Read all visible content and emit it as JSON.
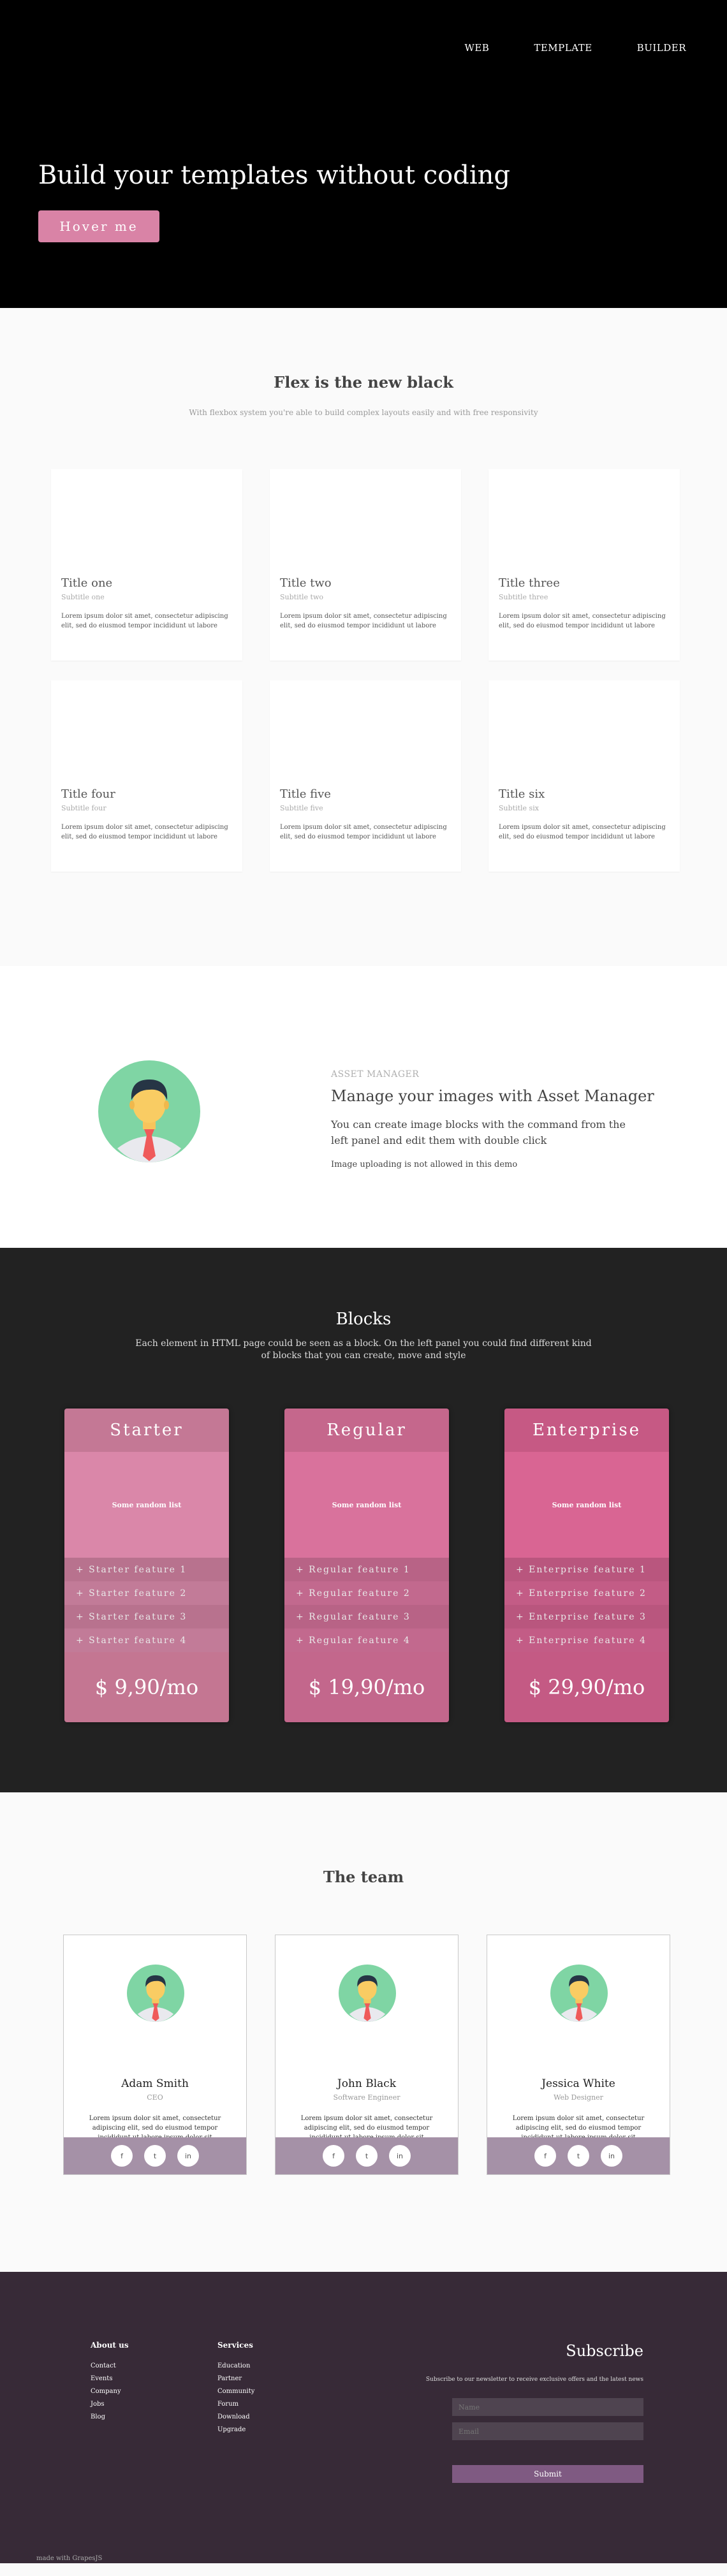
{
  "nav": {
    "items": [
      "WEB",
      "TEMPLATE",
      "BUILDER"
    ]
  },
  "hero": {
    "title": "Build your templates without coding",
    "button": "Hover me"
  },
  "flex": {
    "title": "Flex is the new black",
    "subtitle": "With flexbox system you're able to build complex layouts easily and with free responsivity",
    "cards": [
      {
        "title": "Title one",
        "sub": "Subtitle one",
        "text": "Lorem ipsum dolor sit amet, consectetur adipiscing elit, sed do eiusmod tempor incididunt ut labore"
      },
      {
        "title": "Title two",
        "sub": "Subtitle two",
        "text": "Lorem ipsum dolor sit amet, consectetur adipiscing elit, sed do eiusmod tempor incididunt ut labore"
      },
      {
        "title": "Title three",
        "sub": "Subtitle three",
        "text": "Lorem ipsum dolor sit amet, consectetur adipiscing elit, sed do eiusmod tempor incididunt ut labore"
      },
      {
        "title": "Title four",
        "sub": "Subtitle four",
        "text": "Lorem ipsum dolor sit amet, consectetur adipiscing elit, sed do eiusmod tempor incididunt ut labore"
      },
      {
        "title": "Title five",
        "sub": "Subtitle five",
        "text": "Lorem ipsum dolor sit amet, consectetur adipiscing elit, sed do eiusmod tempor incididunt ut labore"
      },
      {
        "title": "Title six",
        "sub": "Subtitle six",
        "text": "Lorem ipsum dolor sit amet, consectetur adipiscing elit, sed do eiusmod tempor incididunt ut labore"
      }
    ]
  },
  "asset": {
    "kicker": "ASSET MANAGER",
    "title": "Manage your images with Asset Manager",
    "desc": "You can create image blocks with the command from the left panel and edit them with double click",
    "note": "Image uploading is not allowed in this demo"
  },
  "blocks": {
    "title": "Blocks",
    "subtitle": "Each element in HTML page could be seen as a block. On the left panel you could find different kind of blocks that you can create, move and style",
    "plans": [
      {
        "name": "Starter",
        "body": "Some random list",
        "features": [
          "+ Starter feature 1",
          "+ Starter feature 2",
          "+ Starter feature 3",
          "+ Starter feature 4"
        ],
        "price": "$ 9,90/mo",
        "colors": {
          "head": "#c47895",
          "body": "#da87a9",
          "f1": "#c97b9a",
          "f2": "#d485a5",
          "price": "#c47692"
        }
      },
      {
        "name": "Regular",
        "body": "Some random list",
        "features": [
          "+ Regular feature 1",
          "+ Regular feature 2",
          "+ Regular feature 3",
          "+ Regular feature 4"
        ],
        "price": "$ 19,90/mo",
        "colors": {
          "head": "#c5678c",
          "body": "#d9729c",
          "f1": "#c96b91",
          "f2": "#d4719a",
          "price": "#c3678c"
        }
      },
      {
        "name": "Enterprise",
        "body": "Some random list",
        "features": [
          "+ Enterprise feature 1",
          "+ Enterprise feature 2",
          "+ Enterprise feature 3",
          "+ Enterprise feature 4"
        ],
        "price": "$ 29,90/mo",
        "colors": {
          "head": "#c65984",
          "body": "#d96593",
          "f1": "#ca5c88",
          "f2": "#d56391",
          "price": "#c45a84"
        }
      }
    ]
  },
  "team": {
    "title": "The team",
    "members": [
      {
        "name": "Adam Smith",
        "role": "CEO",
        "text": "Lorem ipsum dolor sit amet, consectetur adipiscing elit, sed do eiusmod tempor incididunt ut labore ipsum dolor sit"
      },
      {
        "name": "John Black",
        "role": "Software Engineer",
        "text": "Lorem ipsum dolor sit amet, consectetur adipiscing elit, sed do eiusmod tempor incididunt ut labore ipsum dolor sit"
      },
      {
        "name": "Jessica White",
        "role": "Web Designer",
        "text": "Lorem ipsum dolor sit amet, consectetur adipiscing elit, sed do eiusmod tempor incididunt ut labore ipsum dolor sit"
      }
    ],
    "social": [
      "f",
      "t",
      "in"
    ]
  },
  "footer": {
    "about": {
      "title": "About us",
      "links": [
        "Contact",
        "Events",
        "Company",
        "Jobs",
        "Blog"
      ]
    },
    "services": {
      "title": "Services",
      "links": [
        "Education",
        "Partner",
        "Community",
        "Forum",
        "Download",
        "Upgrade"
      ]
    },
    "subscribe": {
      "title": "Subscribe",
      "desc": "Subscribe to our newsletter to receive exclusive offers and the latest news",
      "name_placeholder": "Name",
      "email_placeholder": "Email",
      "button": "Submit"
    },
    "made_with": "made with GrapesJS"
  }
}
